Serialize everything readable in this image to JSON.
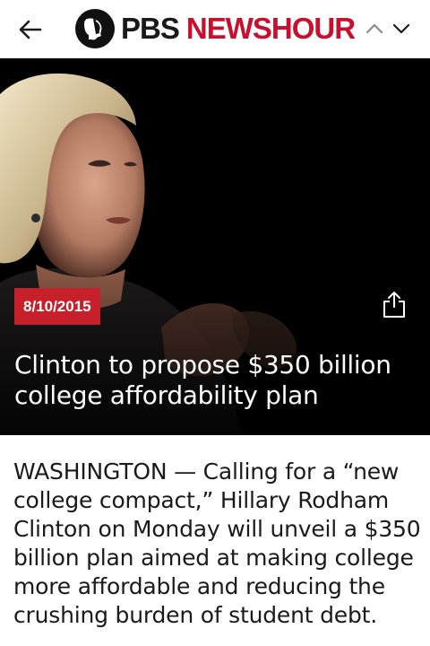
{
  "header": {
    "logo_pbs": "PBS",
    "logo_newshour": "NEWSHOUR",
    "back_icon": "back-arrow-icon",
    "prev_icon": "chevron-up-icon",
    "next_icon": "chevron-down-icon",
    "brand_color": "#c8102e"
  },
  "article": {
    "date": "8/10/2015",
    "headline": "Clinton to propose $350 billion college affordability plan",
    "share_icon": "share-icon",
    "body": "WASHINGTON — Calling for a “new college compact,” Hillary Rodham Clinton on Monday will unveil a $350 billion plan aimed at making college more affordable and reducing the crushing burden of student debt."
  },
  "colors": {
    "badge": "#c8202a",
    "hero_background": "#000000",
    "text": "#1a1a1a"
  }
}
